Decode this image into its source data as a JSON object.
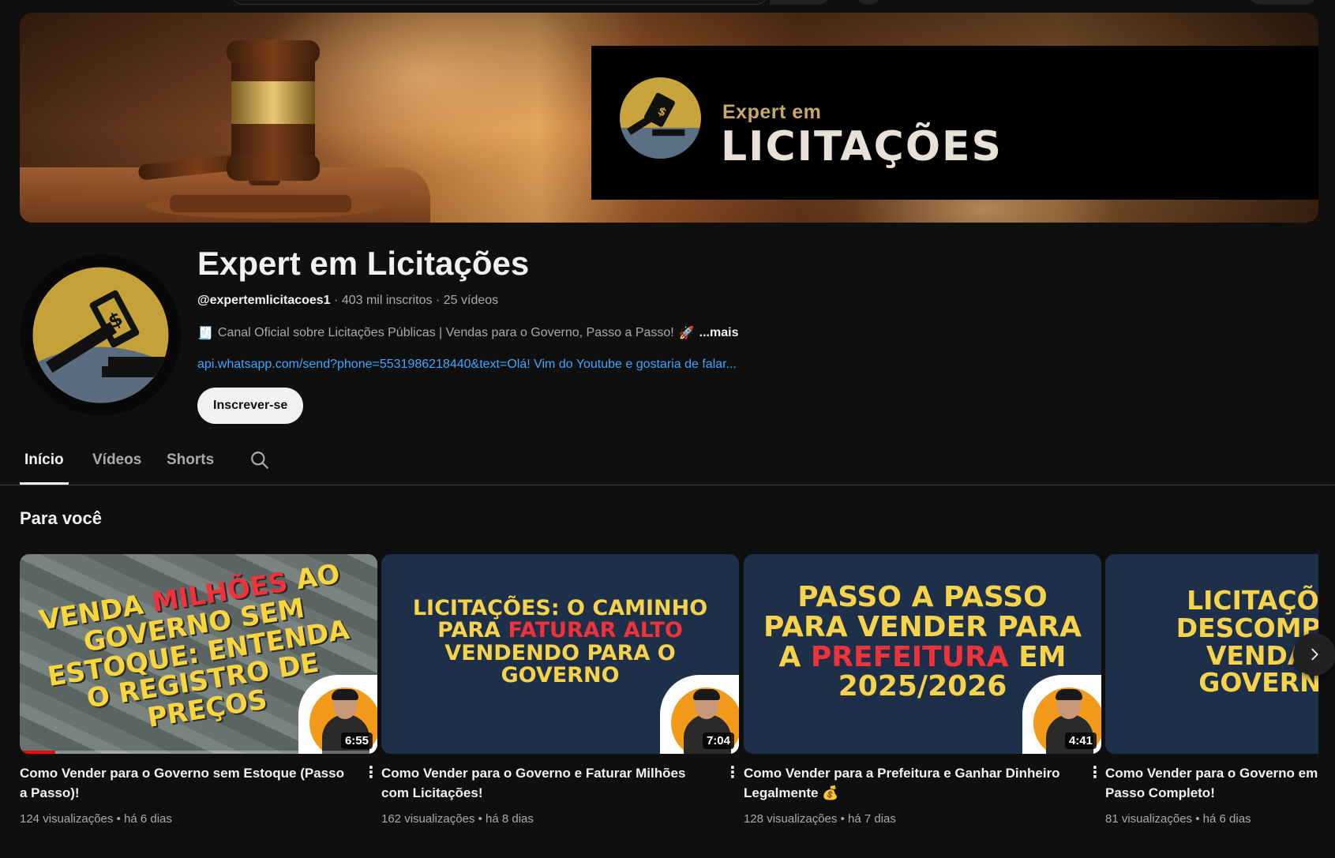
{
  "banner": {
    "brand_small": "Expert em",
    "brand_big": "LICITAÇÕES"
  },
  "channel": {
    "title": "Expert em Licitações",
    "handle": "@expertemlicitacoes1",
    "subscribers": "403 mil inscritos",
    "video_count": "25 vídeos",
    "separator": "·",
    "description": "Canal Oficial sobre Licitações Públicas | Vendas para o Governo, Passo a Passo!",
    "description_prefix_icon": "🧾",
    "description_suffix_icon": "🚀",
    "more_label": "...mais",
    "link": "api.whatsapp.com/send?phone=5531986218440&text=Olá! Vim do Youtube e gostaria de falar...",
    "subscribe_label": "Inscrever-se"
  },
  "tabs": [
    {
      "label": "Início",
      "active": true
    },
    {
      "label": "Vídeos",
      "active": false
    },
    {
      "label": "Shorts",
      "active": false
    }
  ],
  "section": {
    "title": "Para você"
  },
  "videos": [
    {
      "thumb_lines": [
        "VENDA ",
        "MILHÕES",
        " AO GOVERNO SEM ESTOQUE: ENTENDA O REGISTRO DE PREÇOS"
      ],
      "duration": "6:55",
      "title": "Como Vender para o Governo sem Estoque (Passo a Passo)!",
      "views": "124 visualizações",
      "age": "há 6 dias",
      "watched_fraction": 0.1
    },
    {
      "thumb_lines": [
        "LICITAÇÕES: O CAMINHO PARA ",
        "FATURAR ALTO",
        " VENDENDO PARA O GOVERNO"
      ],
      "duration": "7:04",
      "title": "Como Vender para o Governo e Faturar Milhões com Licitações!",
      "views": "162 visualizações",
      "age": "há 8 dias"
    },
    {
      "thumb_lines": [
        "PASSO A PASSO PARA VENDER PARA A ",
        "PREFEITURA",
        " EM 2025/2026"
      ],
      "duration": "4:41",
      "title": "Como Vender para a Prefeitura e Ganhar Dinheiro Legalmente 💰",
      "views": "128 visualizações",
      "age": "há 7 dias"
    },
    {
      "thumb_lines": [
        "LICITAÇÕES DESCOMPLIC VENDA P GOVERNO"
      ],
      "title": "Como Vender para o Governo em Passo Completo!",
      "views": "81 visualizações",
      "age": "há 6 dias"
    }
  ],
  "meta_separator": "•",
  "colors": {
    "background": "#0f0f0f",
    "link": "#3ea6ff",
    "thumb_yellow": "#f6d34a",
    "thumb_red": "#f0323a",
    "thumb_navy": "#1e2f4a",
    "progress_red": "#ff0000"
  },
  "icons": [
    "search-icon",
    "more-vert-icon",
    "chevron-right-icon",
    "gavel-logo"
  ]
}
